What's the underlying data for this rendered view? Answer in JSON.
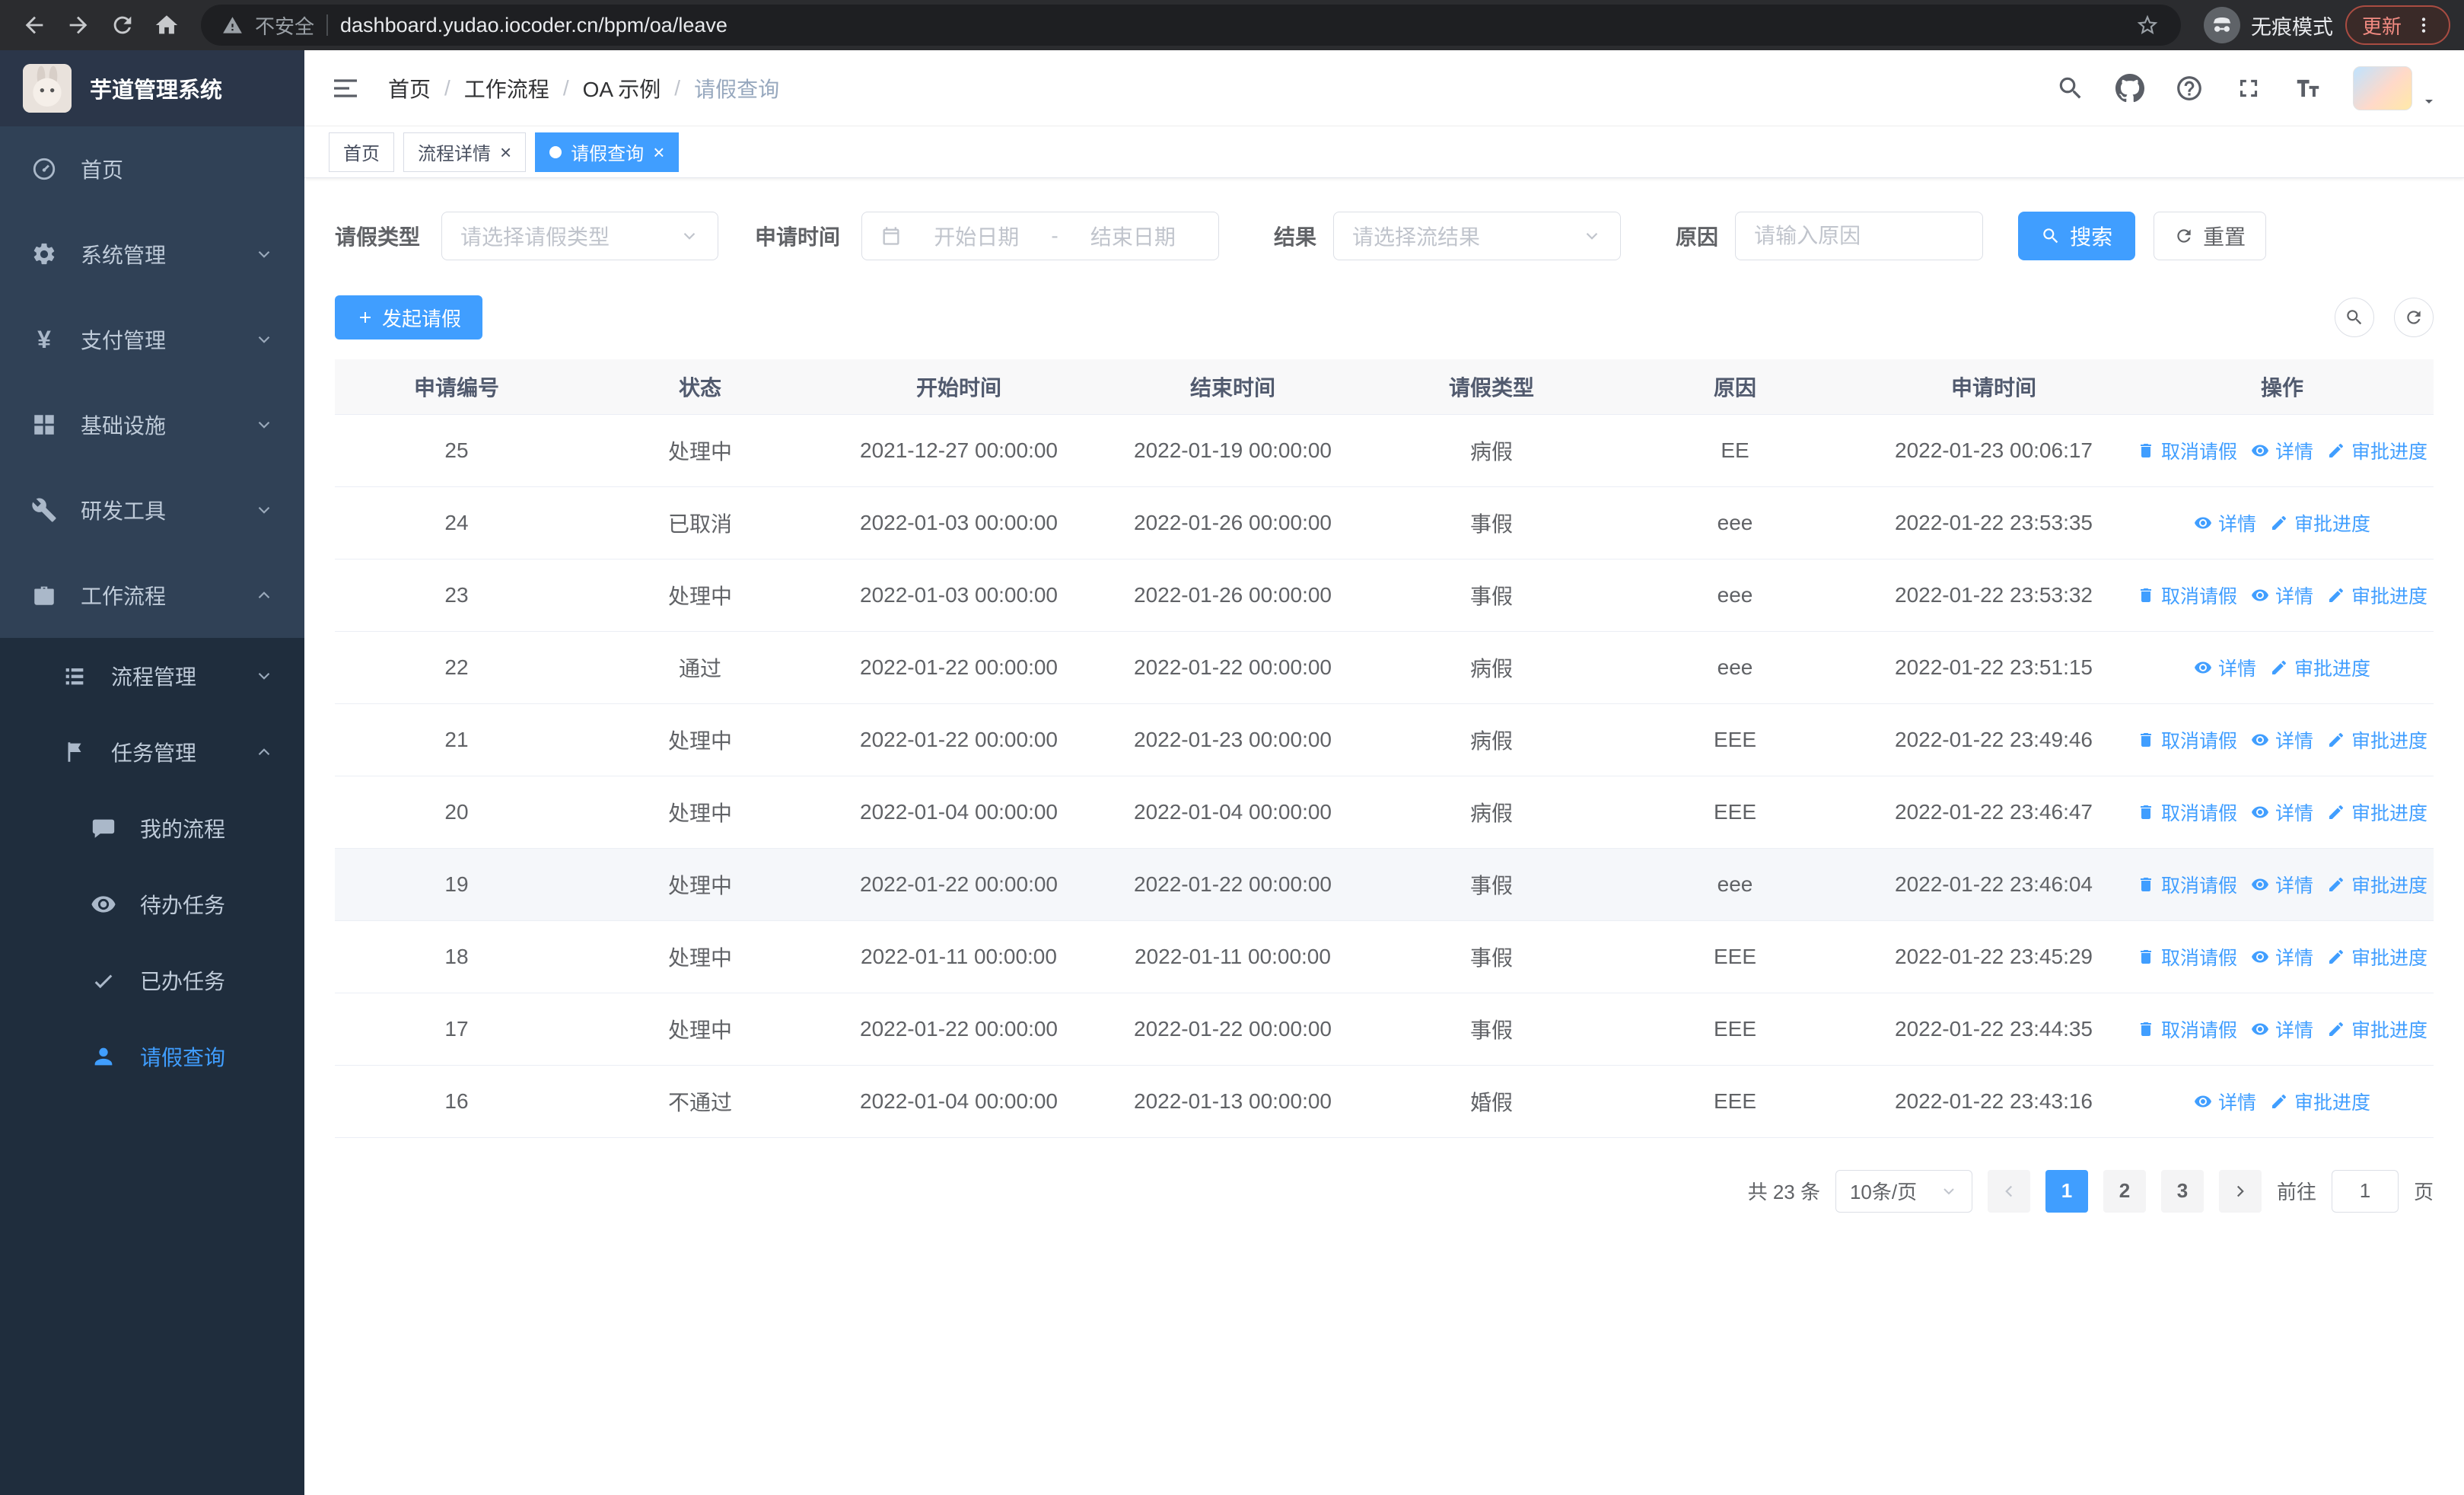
{
  "browser": {
    "security_label": "不安全",
    "url": "dashboard.yudao.iocoder.cn/bpm/oa/leave",
    "incognito_label": "无痕模式",
    "update_label": "更新"
  },
  "glyphs": {
    "close": "×",
    "breadcrumb_separator": "/",
    "yen": "¥"
  },
  "sidebar": {
    "app_title": "芋道管理系统",
    "items": [
      {
        "label": "首页"
      },
      {
        "label": "系统管理"
      },
      {
        "label": "支付管理"
      },
      {
        "label": "基础设施"
      },
      {
        "label": "研发工具"
      },
      {
        "label": "工作流程"
      }
    ],
    "workflow_children": [
      {
        "label": "流程管理"
      },
      {
        "label": "任务管理"
      }
    ],
    "task_children": [
      {
        "label": "我的流程"
      },
      {
        "label": "待办任务"
      },
      {
        "label": "已办任务"
      },
      {
        "label": "请假查询"
      }
    ]
  },
  "header": {
    "breadcrumb": [
      "首页",
      "工作流程",
      "OA 示例",
      "请假查询"
    ]
  },
  "tabs": [
    {
      "label": "首页"
    },
    {
      "label": "流程详情"
    },
    {
      "label": "请假查询"
    }
  ],
  "filters": {
    "leave_type_label": "请假类型",
    "leave_type_placeholder": "请选择请假类型",
    "apply_time_label": "申请时间",
    "start_placeholder": "开始日期",
    "range_separator": "-",
    "end_placeholder": "结束日期",
    "result_label": "结果",
    "result_placeholder": "请选择流结果",
    "reason_label": "原因",
    "reason_placeholder": "请输入原因",
    "search_label": "搜索",
    "reset_label": "重置"
  },
  "toolbar": {
    "create_label": "发起请假"
  },
  "table": {
    "columns": [
      "申请编号",
      "状态",
      "开始时间",
      "结束时间",
      "请假类型",
      "原因",
      "申请时间",
      "操作"
    ],
    "rows": [
      {
        "id": "25",
        "status": "处理中",
        "start": "2021-12-27 00:00:00",
        "end": "2022-01-19 00:00:00",
        "type": "病假",
        "reason": "EE",
        "applied": "2022-01-23 00:06:17",
        "highlight": false,
        "actions": [
          {
            "label": "取消请假",
            "icon": "delete-icon"
          },
          {
            "label": "详情",
            "icon": "view-icon"
          },
          {
            "label": "审批进度",
            "icon": "edit-icon"
          }
        ]
      },
      {
        "id": "24",
        "status": "已取消",
        "start": "2022-01-03 00:00:00",
        "end": "2022-01-26 00:00:00",
        "type": "事假",
        "reason": "eee",
        "applied": "2022-01-22 23:53:35",
        "highlight": false,
        "actions": [
          {
            "label": "详情",
            "icon": "view-icon"
          },
          {
            "label": "审批进度",
            "icon": "edit-icon"
          }
        ]
      },
      {
        "id": "23",
        "status": "处理中",
        "start": "2022-01-03 00:00:00",
        "end": "2022-01-26 00:00:00",
        "type": "事假",
        "reason": "eee",
        "applied": "2022-01-22 23:53:32",
        "highlight": false,
        "actions": [
          {
            "label": "取消请假",
            "icon": "delete-icon"
          },
          {
            "label": "详情",
            "icon": "view-icon"
          },
          {
            "label": "审批进度",
            "icon": "edit-icon"
          }
        ]
      },
      {
        "id": "22",
        "status": "通过",
        "start": "2022-01-22 00:00:00",
        "end": "2022-01-22 00:00:00",
        "type": "病假",
        "reason": "eee",
        "applied": "2022-01-22 23:51:15",
        "highlight": false,
        "actions": [
          {
            "label": "详情",
            "icon": "view-icon"
          },
          {
            "label": "审批进度",
            "icon": "edit-icon"
          }
        ]
      },
      {
        "id": "21",
        "status": "处理中",
        "start": "2022-01-22 00:00:00",
        "end": "2022-01-23 00:00:00",
        "type": "病假",
        "reason": "EEE",
        "applied": "2022-01-22 23:49:46",
        "highlight": false,
        "actions": [
          {
            "label": "取消请假",
            "icon": "delete-icon"
          },
          {
            "label": "详情",
            "icon": "view-icon"
          },
          {
            "label": "审批进度",
            "icon": "edit-icon"
          }
        ]
      },
      {
        "id": "20",
        "status": "处理中",
        "start": "2022-01-04 00:00:00",
        "end": "2022-01-04 00:00:00",
        "type": "病假",
        "reason": "EEE",
        "applied": "2022-01-22 23:46:47",
        "highlight": false,
        "actions": [
          {
            "label": "取消请假",
            "icon": "delete-icon"
          },
          {
            "label": "详情",
            "icon": "view-icon"
          },
          {
            "label": "审批进度",
            "icon": "edit-icon"
          }
        ]
      },
      {
        "id": "19",
        "status": "处理中",
        "start": "2022-01-22 00:00:00",
        "end": "2022-01-22 00:00:00",
        "type": "事假",
        "reason": "eee",
        "applied": "2022-01-22 23:46:04",
        "highlight": true,
        "actions": [
          {
            "label": "取消请假",
            "icon": "delete-icon"
          },
          {
            "label": "详情",
            "icon": "view-icon"
          },
          {
            "label": "审批进度",
            "icon": "edit-icon"
          }
        ]
      },
      {
        "id": "18",
        "status": "处理中",
        "start": "2022-01-11 00:00:00",
        "end": "2022-01-11 00:00:00",
        "type": "事假",
        "reason": "EEE",
        "applied": "2022-01-22 23:45:29",
        "highlight": false,
        "actions": [
          {
            "label": "取消请假",
            "icon": "delete-icon"
          },
          {
            "label": "详情",
            "icon": "view-icon"
          },
          {
            "label": "审批进度",
            "icon": "edit-icon"
          }
        ]
      },
      {
        "id": "17",
        "status": "处理中",
        "start": "2022-01-22 00:00:00",
        "end": "2022-01-22 00:00:00",
        "type": "事假",
        "reason": "EEE",
        "applied": "2022-01-22 23:44:35",
        "highlight": false,
        "actions": [
          {
            "label": "取消请假",
            "icon": "delete-icon"
          },
          {
            "label": "详情",
            "icon": "view-icon"
          },
          {
            "label": "审批进度",
            "icon": "edit-icon"
          }
        ]
      },
      {
        "id": "16",
        "status": "不通过",
        "start": "2022-01-04 00:00:00",
        "end": "2022-01-13 00:00:00",
        "type": "婚假",
        "reason": "EEE",
        "applied": "2022-01-22 23:43:16",
        "highlight": false,
        "actions": [
          {
            "label": "详情",
            "icon": "view-icon"
          },
          {
            "label": "审批进度",
            "icon": "edit-icon"
          }
        ]
      }
    ]
  },
  "pagination": {
    "total_label": "共 23 条",
    "page_size_label": "10条/页",
    "pages": [
      "1",
      "2",
      "3"
    ],
    "active_page": "1",
    "goto_label": "前往",
    "goto_value": "1",
    "page_unit": "页"
  },
  "colors": {
    "primary": "#409eff",
    "sidebar_bg": "#304156",
    "submenu_bg": "#1f2d3d"
  }
}
